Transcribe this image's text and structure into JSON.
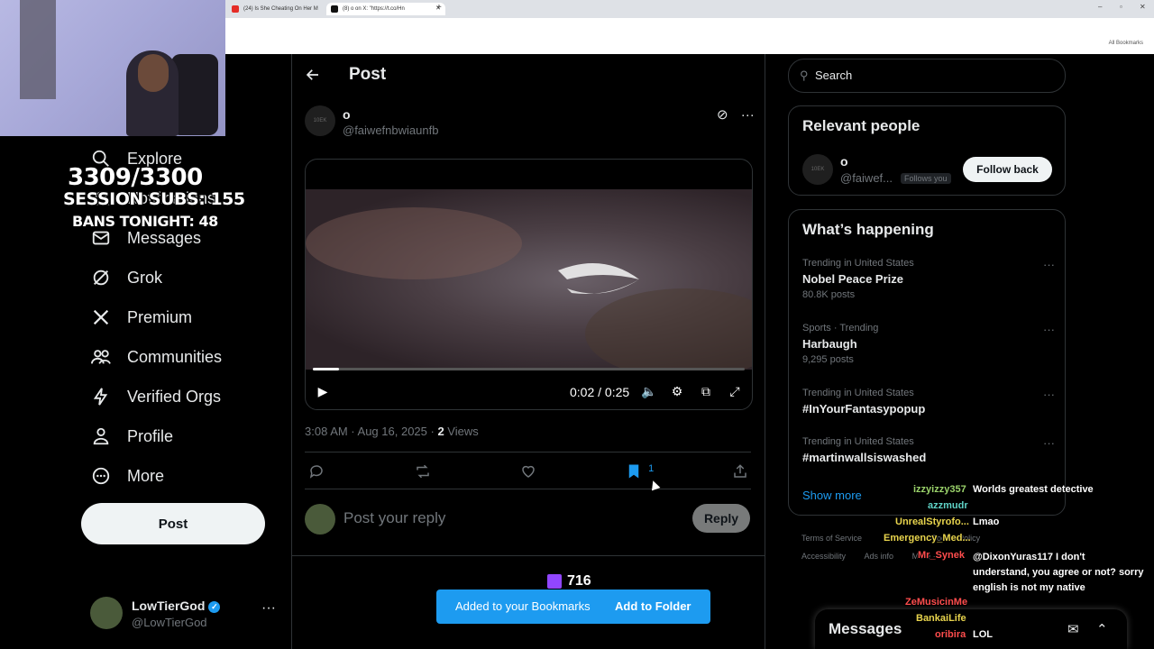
{
  "browser": {
    "tabs": [
      {
        "label": "(24) Is She Cheating On Her M"
      },
      {
        "label": "(8) o on X: \"https://t.co/Hn"
      }
    ],
    "bookmarks_label": "All Bookmarks"
  },
  "nav": {
    "items": [
      {
        "label": "Explore",
        "icon": "search-icon"
      },
      {
        "label": "Notifications",
        "icon": "bell-icon"
      },
      {
        "label": "Messages",
        "icon": "mail-icon"
      },
      {
        "label": "Grok",
        "icon": "grok-icon"
      },
      {
        "label": "Premium",
        "icon": "x-logo-icon"
      },
      {
        "label": "Communities",
        "icon": "people-icon"
      },
      {
        "label": "Verified Orgs",
        "icon": "lightning-icon"
      },
      {
        "label": "Profile",
        "icon": "person-icon"
      },
      {
        "label": "More",
        "icon": "more-circle-icon"
      }
    ],
    "post_button": "Post",
    "account": {
      "name": "LowTierGod",
      "handle": "@LowTierGod"
    }
  },
  "main": {
    "header_title": "Post",
    "author": {
      "name": "o",
      "handle": "@faiwefnbwiaunfb",
      "avatar_text": "10EK"
    },
    "video": {
      "time": "0:02 / 0:25",
      "progress": 0.06
    },
    "meta": {
      "time": "3:08 AM · Aug 16, 2025 · ",
      "views_count": "2",
      "views_label": " Views"
    },
    "actions": {
      "bookmark_count": "1"
    },
    "reply": {
      "placeholder": "Post your reply",
      "button": "Reply"
    },
    "toast": {
      "message": "Added to your Bookmarks",
      "action": "Add to Folder"
    }
  },
  "sidebar_right": {
    "search_placeholder": "Search",
    "relevant": {
      "title": "Relevant people",
      "person": {
        "name": "o",
        "handle": "@faiwef...",
        "follows_you": "Follows you",
        "avatar_text": "10EK"
      },
      "follow_button": "Follow back"
    },
    "happening": {
      "title": "What’s happening",
      "trends": [
        {
          "context": "Trending in United States",
          "title": "Nobel Peace Prize",
          "count": "80.8K posts"
        },
        {
          "context": "Sports · Trending",
          "title": "Harbaugh",
          "count": "9,295 posts"
        },
        {
          "context": "Trending in United States",
          "title": "#InYourFantasypopup",
          "count": ""
        },
        {
          "context": "Trending in United States",
          "title": "#martinwallsiswashed",
          "count": ""
        }
      ],
      "show_more": "Show more"
    },
    "footer": {
      "row1": [
        "Terms of Service",
        "Cookie Policy"
      ],
      "row2": [
        "Accessibility",
        "Ads info",
        "More ···"
      ]
    },
    "messages_label": "Messages"
  },
  "stream_overlay": {
    "counter": "3309/3300",
    "session_subs": "SESSION SUBS: 155",
    "bans": "BANS TONIGHT: 48",
    "viewers": "716",
    "chat": [
      {
        "user": "izzyizzy357",
        "message": "Worlds greatest detective",
        "color": "#9bd36b"
      },
      {
        "user": "azzmudr",
        "message": "",
        "color": "#5fd3c7"
      },
      {
        "user": "UnrealStyrofo...",
        "message": "Lmao",
        "color": "#e8d44d"
      },
      {
        "user": "Emergency_Med...",
        "message": "",
        "color": "#e8d44d"
      },
      {
        "user": "Mr_Synek",
        "message": "@DixonYuras117 I don't understand, you agree or not? sorry english is not my native",
        "color": "#ff4d4d"
      },
      {
        "user": "ZeMusicinMe",
        "message": "",
        "color": "#ff4d4d"
      },
      {
        "user": "BankaiLife",
        "message": "",
        "color": "#e8d44d"
      },
      {
        "user": "oribira",
        "message": "LOL",
        "color": "#ff4d4d"
      }
    ]
  }
}
